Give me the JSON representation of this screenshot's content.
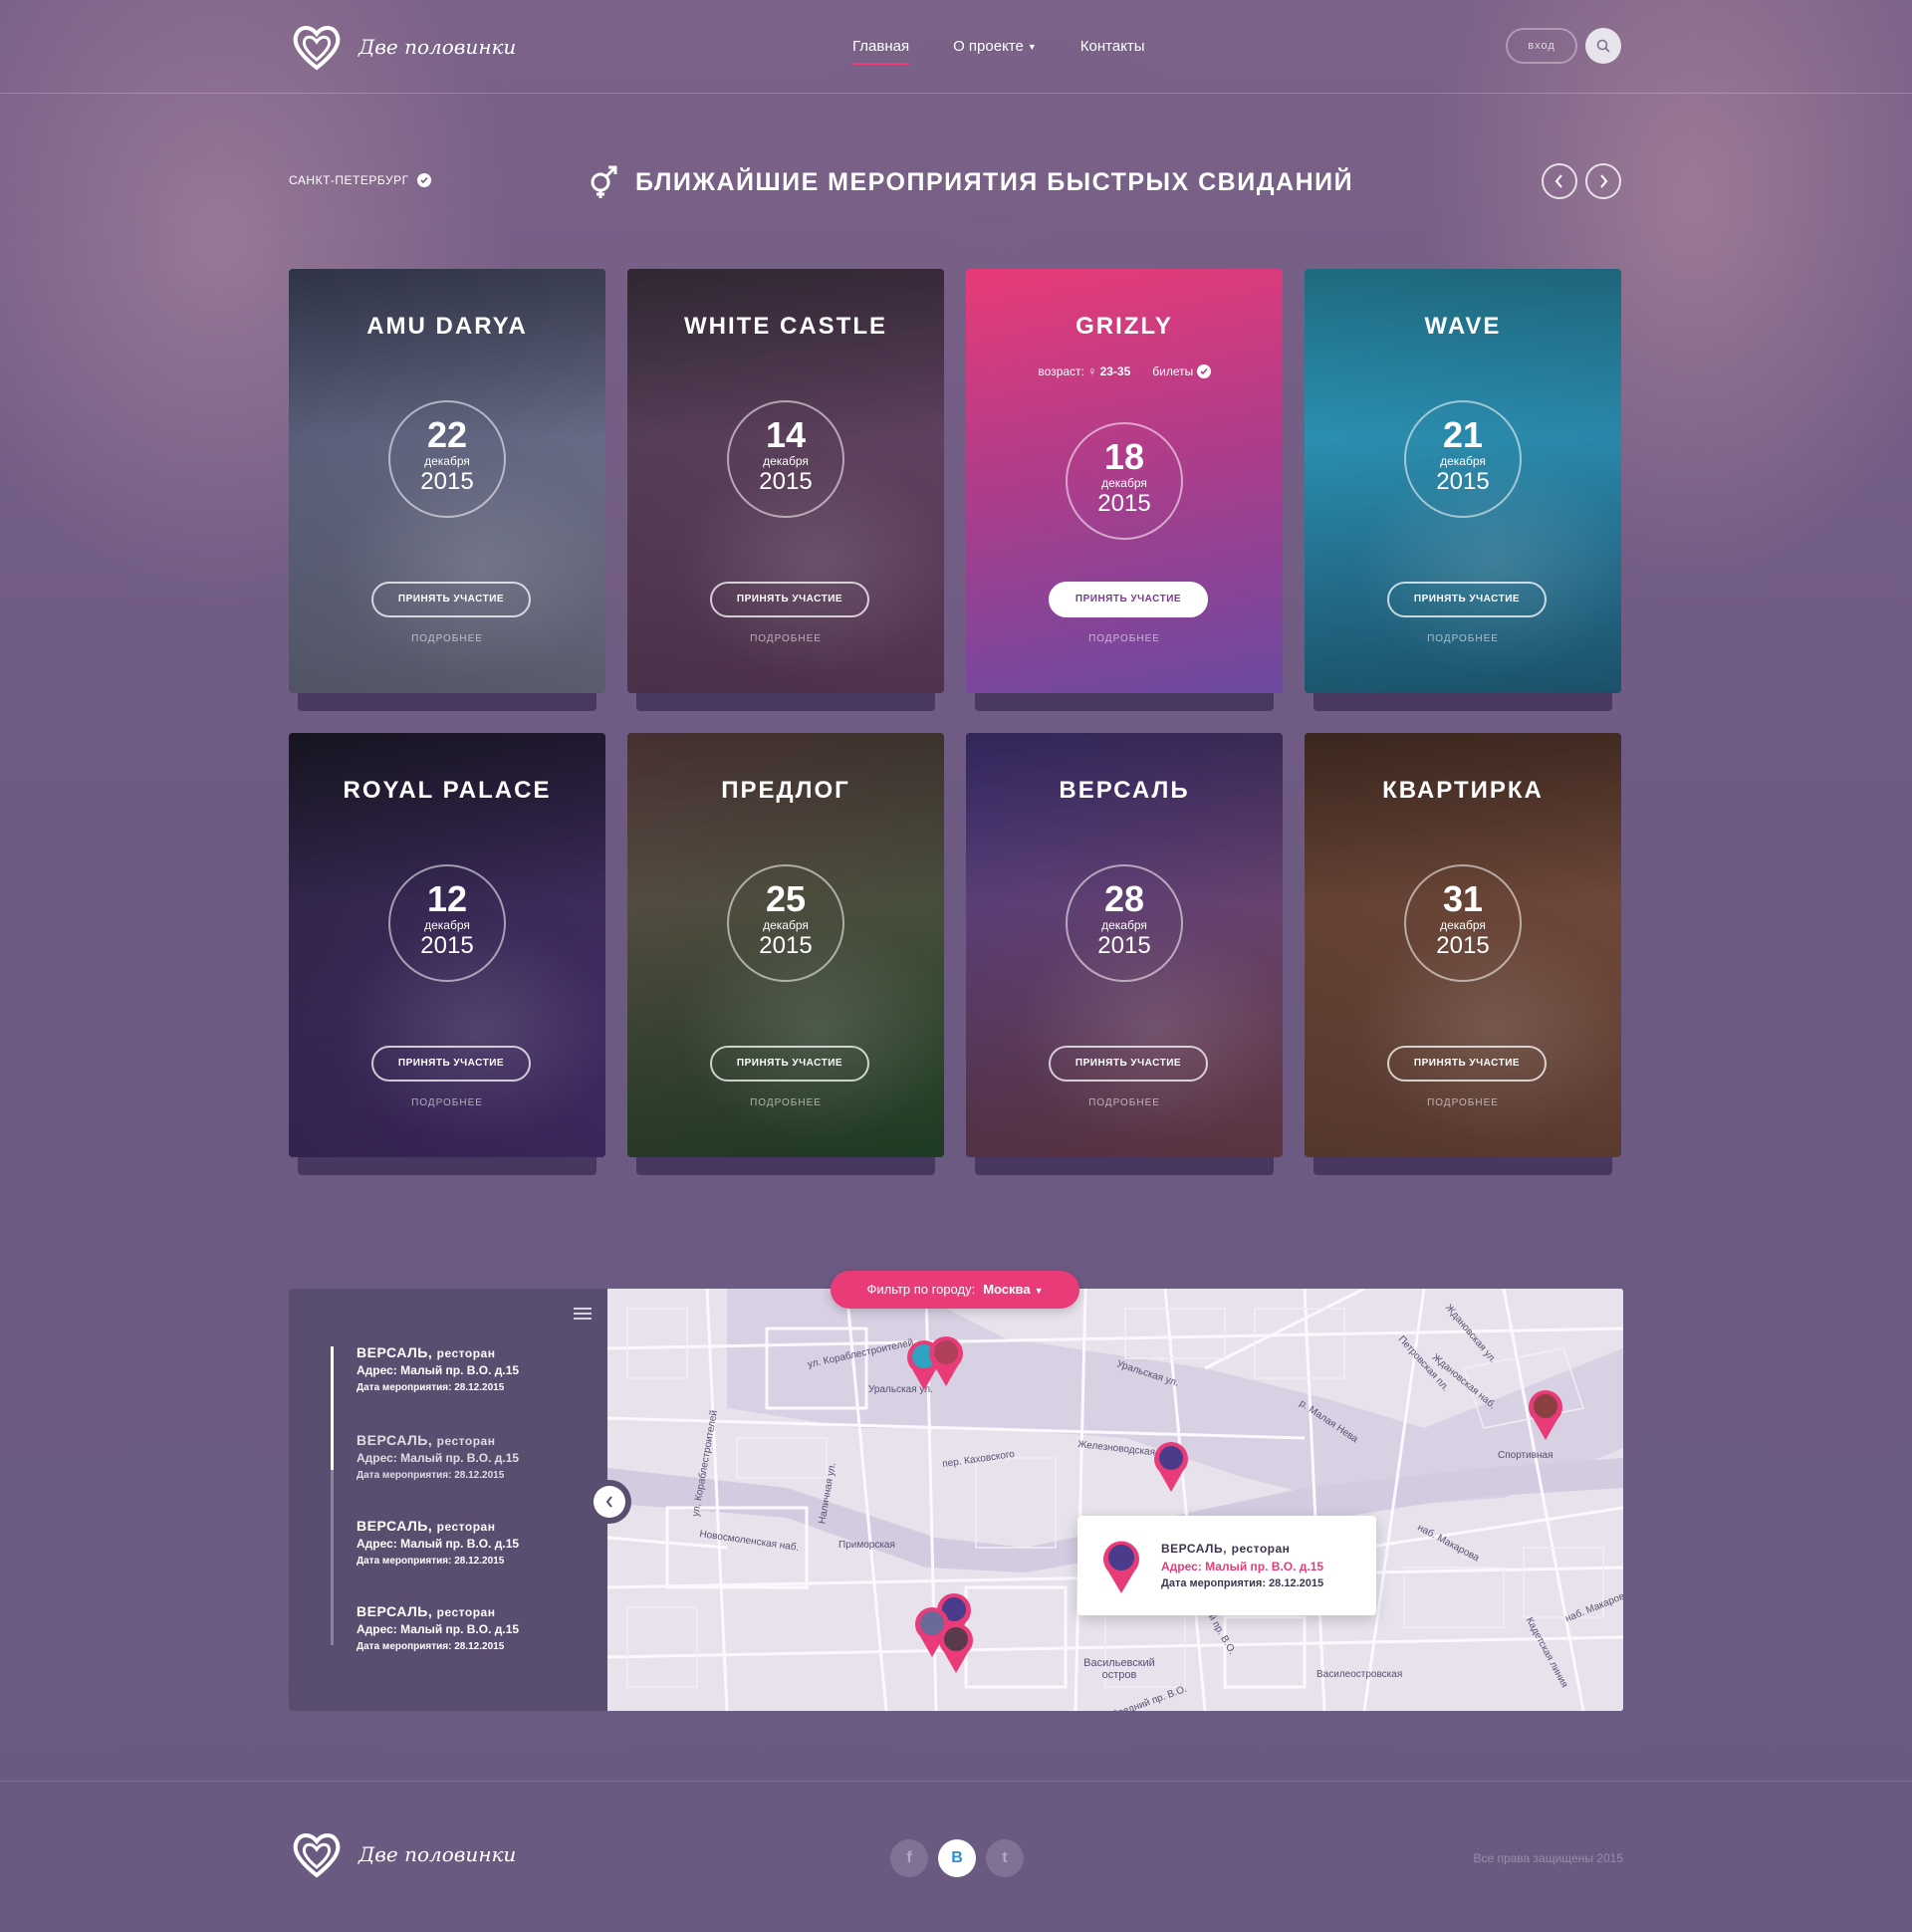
{
  "colors": {
    "accent": "#e83b78",
    "background": "#6a5a82",
    "panel": "#5a4e70",
    "map": "#e7e2ec"
  },
  "brand": {
    "name": "Две половинки",
    "logo_icon": "double-heart-icon"
  },
  "nav": {
    "items": [
      {
        "label": "Главная",
        "active": true
      },
      {
        "label": "О проекте",
        "dropdown": true
      },
      {
        "label": "Контакты"
      }
    ],
    "login": "вход",
    "search_icon": "search-icon"
  },
  "section": {
    "city": "САНКТ-ПЕТЕРБУРГ",
    "title": "БЛИЖАЙШИЕ МЕРОПРИЯТИЯ БЫСТРЫХ СВИДАНИЙ",
    "title_icon": "gender-symbol-icon"
  },
  "cards": [
    {
      "name": "AMU DARYA",
      "day": "22",
      "month": "декабря",
      "year": "2015",
      "join": "ПРИНЯТЬ УЧАСТИЕ",
      "more": "ПОДРОБНЕЕ",
      "tone": [
        "#4a4f6c",
        "#8b8ea8"
      ]
    },
    {
      "name": "WHITE CASTLE",
      "day": "14",
      "month": "декабря",
      "year": "2015",
      "join": "ПРИНЯТЬ УЧАСТИЕ",
      "more": "ПОДРОБНЕЕ",
      "tone": [
        "#4a3b4e",
        "#7b4d77"
      ]
    },
    {
      "name": "GRIZLY",
      "day": "18",
      "month": "декабря",
      "year": "2015",
      "join": "ПРИНЯТЬ УЧАСТИЕ",
      "more": "ПОДРОБНЕЕ",
      "tone": [
        "#e83b78",
        "#6a4aa0"
      ],
      "highlight": true,
      "age_label": "возраст:",
      "age": "23-35",
      "tickets_label": "билеты"
    },
    {
      "name": "WAVE",
      "day": "21",
      "month": "декабря",
      "year": "2015",
      "join": "ПРИНЯТЬ УЧАСТИЕ",
      "more": "ПОДРОБНЕЕ",
      "tone": [
        "#2ea3c3",
        "#2b7ba3"
      ]
    },
    {
      "name": "ROYAL PALACE",
      "day": "12",
      "month": "декабря",
      "year": "2015",
      "join": "ПРИНЯТЬ УЧАСТИЕ",
      "more": "ПОДРОБНЕЕ",
      "tone": [
        "#231f33",
        "#5b3a8b"
      ]
    },
    {
      "name": "ПРЕДЛОГ",
      "day": "25",
      "month": "декабря",
      "year": "2015",
      "join": "ПРИНЯТЬ УЧАСТИЕ",
      "more": "ПОДРОБНЕЕ",
      "tone": [
        "#6a4a4a",
        "#2f5a35"
      ]
    },
    {
      "name": "ВЕРСАЛЬ",
      "day": "28",
      "month": "декабря",
      "year": "2015",
      "join": "ПРИНЯТЬ УЧАСТИЕ",
      "more": "ПОДРОБНЕЕ",
      "tone": [
        "#4b3a8b",
        "#8a5060"
      ]
    },
    {
      "name": "КВАРТИРКА",
      "day": "31",
      "month": "декабря",
      "year": "2015",
      "join": "ПРИНЯТЬ УЧАСТИЕ",
      "more": "ПОДРОБНЕЕ",
      "tone": [
        "#5a3b2e",
        "#8a5a4a"
      ]
    }
  ],
  "filter": {
    "label": "Фильтр по городу:",
    "value": "Москва"
  },
  "events_list": [
    {
      "name": "ВЕРСАЛЬ,",
      "type": "ресторан",
      "address": "Адрес: Малый пр. В.О. д.15",
      "date": "Дата мероприятия: 28.12.2015"
    },
    {
      "name": "ВЕРСАЛЬ,",
      "type": "ресторан",
      "address": "Адрес: Малый пр. В.О. д.15",
      "date": "Дата мероприятия: 28.12.2015"
    },
    {
      "name": "ВЕРСАЛЬ,",
      "type": "ресторан",
      "address": "Адрес: Малый пр. В.О. д.15",
      "date": "Дата мероприятия: 28.12.2015"
    },
    {
      "name": "ВЕРСАЛЬ,",
      "type": "ресторан",
      "address": "Адрес: Малый пр. В.О. д.15",
      "date": "Дата мероприятия: 28.12.2015"
    }
  ],
  "map": {
    "labels": [
      "ул. Кораблестроителей",
      "ул. Кораблестроителей",
      "Уральская ул.",
      "Уральская ул.",
      "Железноводская ул.",
      "р. Малая Нева",
      "Ждановская ул.",
      "Петровская пл.",
      "Ждановская наб.",
      "Спортивная",
      "пер. Каховского",
      "Наличная ул.",
      "Новосмоленская наб.",
      "Приморская",
      "наб. Макарова",
      "наб. Макарова",
      "Васильевский остров",
      "Василеостровская",
      "Кадетская линия",
      "Средний пр. В.О.",
      "Малый пр. В.О."
    ],
    "popup": {
      "name": "ВЕРСАЛЬ,",
      "type": "ресторан",
      "address": "Адрес: Малый пр. В.О. д.15",
      "date": "Дата мероприятия: 28.12.2015"
    }
  },
  "footer": {
    "socials": [
      {
        "label": "f",
        "icon": "facebook-icon"
      },
      {
        "label": "B",
        "icon": "vk-icon"
      },
      {
        "label": "t",
        "icon": "twitter-icon"
      }
    ],
    "copyright": "Все права защищены 2015"
  }
}
